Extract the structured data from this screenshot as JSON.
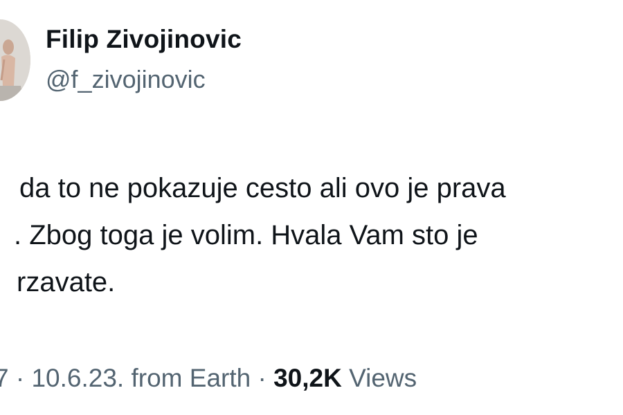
{
  "author": {
    "name": "Filip Zivojinovic",
    "handle": "@f_zivojinovic"
  },
  "tweet": {
    "lines": [
      "da to ne pokazuje cesto ali ovo je prava",
      ". Zbog toga je volim. Hvala Vam sto je",
      "rzavate."
    ]
  },
  "meta": {
    "time_fragment": "7",
    "sep1": " · ",
    "date": "10.6.23.",
    "source": " from Earth",
    "sep2": " · ",
    "views_count": "30,2K",
    "views_label": " Views"
  },
  "colors": {
    "text": "#0f1419",
    "secondary": "#536471",
    "background": "#ffffff"
  }
}
